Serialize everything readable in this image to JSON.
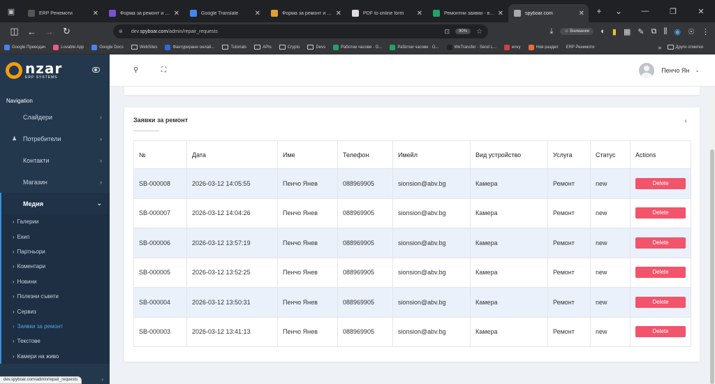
{
  "browser": {
    "tabs": [
      {
        "title": "ERP Ренемоти",
        "color": "#555555",
        "active": false
      },
      {
        "title": "Форма за ремонт и настр",
        "color": "#7b4fd6",
        "active": false
      },
      {
        "title": "Google Translate",
        "color": "#4285f4",
        "active": false
      },
      {
        "title": "Форма за ремонт и настр",
        "color": "#e0a030",
        "active": false
      },
      {
        "title": "PDF to online form",
        "color": "#dddddd",
        "active": false
      },
      {
        "title": "Ремонтни заявки - всеки н",
        "color": "#1fa463",
        "active": false
      },
      {
        "title": "spyboar.com",
        "color": "#aaaaaa",
        "active": true
      }
    ],
    "url_prefix": "dev.",
    "url_domain": "spyboar.com",
    "url_path": "/admin/repair_requests",
    "zoom": "90%",
    "profile_label": "Внимание",
    "bookmarks": [
      {
        "label": "Google Преводач",
        "color": "#4285f4",
        "folder": false
      },
      {
        "label": "Lovable App",
        "color": "#e85b8a",
        "folder": false
      },
      {
        "label": "Google Docs",
        "color": "#4285f4",
        "folder": false
      },
      {
        "label": "WebSites",
        "color": "",
        "folder": true
      },
      {
        "label": "Фактуриране онлай...",
        "color": "#2d6bd8",
        "folder": false
      },
      {
        "label": "Tutorials",
        "color": "",
        "folder": true
      },
      {
        "label": "APIs",
        "color": "",
        "folder": true
      },
      {
        "label": "Crypto",
        "color": "",
        "folder": true
      },
      {
        "label": "Devs",
        "color": "",
        "folder": true
      },
      {
        "label": "Работни часове · G...",
        "color": "#1fa463",
        "folder": false
      },
      {
        "label": "Работни часове · G...",
        "color": "#1fa463",
        "folder": false
      },
      {
        "label": "WeTransfer · Send L...",
        "color": "#222222",
        "folder": false
      },
      {
        "label": "envy",
        "color": "#d04040",
        "folder": false
      },
      {
        "label": "Нов раздел",
        "color": "#e86c3a",
        "folder": false
      },
      {
        "label": "ERP Ренемоти",
        "color": "",
        "folder": false
      }
    ],
    "bookmarks_more": "Други отметки",
    "status_url": "dev.spyboar.com/admin/repair_requests"
  },
  "sidebar": {
    "logo_text": "nzar",
    "logo_sub": "ERP SYSTEMS",
    "nav_title": "Navigation",
    "items": [
      {
        "label": "Слайдери"
      },
      {
        "label": "Потребители"
      },
      {
        "label": "Контакти"
      },
      {
        "label": "Магазин"
      },
      {
        "label": "Медия"
      }
    ],
    "subitems": [
      {
        "label": "Галерии"
      },
      {
        "label": "Екип"
      },
      {
        "label": "Партньори"
      },
      {
        "label": "Коментари"
      },
      {
        "label": "Новини"
      },
      {
        "label": "Полезни съвети"
      },
      {
        "label": "Сервиз"
      },
      {
        "label": "Заявки за ремонт"
      },
      {
        "label": "Текстове"
      },
      {
        "label": "Камери на живо"
      }
    ]
  },
  "header": {
    "user_name": "Пенчо Ян"
  },
  "card": {
    "title": "Заявки за ремонт"
  },
  "table": {
    "headers": [
      "№",
      "Дата",
      "Име",
      "Телефон",
      "Имейл",
      "Вид устройство",
      "Услуга",
      "Статус",
      "Actions"
    ],
    "delete_label": "Delete",
    "rows": [
      {
        "id": "SB-000008",
        "date": "2026-03-12 14:05:55",
        "name": "Пенчо Янев",
        "phone": "088969905",
        "email": "sionsion@abv.bg",
        "device": "Камера",
        "service": "Ремонт",
        "status": "new"
      },
      {
        "id": "SB-000007",
        "date": "2026-03-12 14:04:26",
        "name": "Пенчо Янев",
        "phone": "088969905",
        "email": "sionsion@abv.bg",
        "device": "Камера",
        "service": "Ремонт",
        "status": "new"
      },
      {
        "id": "SB-000006",
        "date": "2026-03-12 13:57:19",
        "name": "Пенчо Янев",
        "phone": "088969905",
        "email": "sionsion@abv.bg",
        "device": "Камера",
        "service": "Ремонт",
        "status": "new"
      },
      {
        "id": "SB-000005",
        "date": "2026-03-12 13:52:25",
        "name": "Пенчо Янев",
        "phone": "088969905",
        "email": "sionsion@abv.bg",
        "device": "Камера",
        "service": "Ремонт",
        "status": "new"
      },
      {
        "id": "SB-000004",
        "date": "2026-03-12 13:50:31",
        "name": "Пенчо Янев",
        "phone": "088969905",
        "email": "sionsion@abv.bg",
        "device": "Камера",
        "service": "Ремонт",
        "status": "new"
      },
      {
        "id": "SB-000003",
        "date": "2026-03-12 13:41:13",
        "name": "Пенчо Янев",
        "phone": "088969905",
        "email": "sionsion@abv.bg",
        "device": "Камера",
        "service": "Ремонт",
        "status": "new"
      }
    ]
  }
}
